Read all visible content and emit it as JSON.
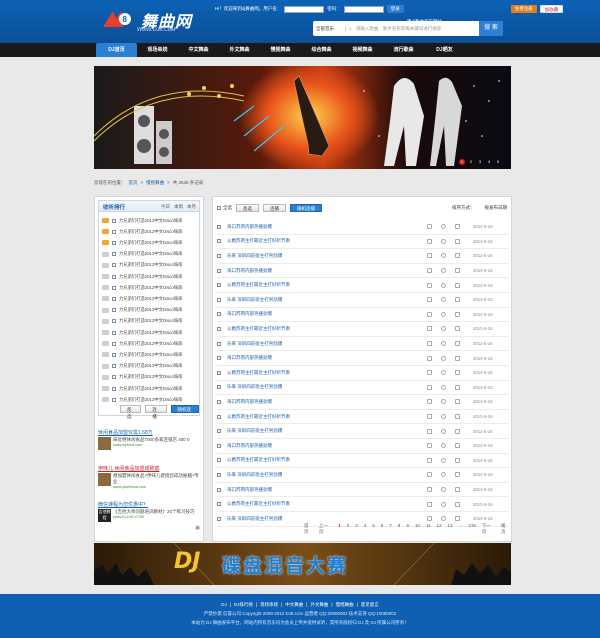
{
  "header": {
    "logo_text": "舞曲网",
    "logo_url": "WwW.DJ8.CoM",
    "welcome": "Hi！欢迎来到dj舞曲网。用户名：",
    "password_label": "密码：",
    "login_btn": "登录",
    "register_btn": "免费注册",
    "upload_link": "用dj舞曲发布网站",
    "favorite_link": "加收藏"
  },
  "search": {
    "scope": "全部音乐",
    "placeholder": "请输入歌曲、歌手名称及每关键词进行搜索",
    "button": "搜 索"
  },
  "nav": [
    {
      "label": "DJ首页",
      "active": true
    },
    {
      "label": "现场串烧",
      "active": false
    },
    {
      "label": "中文舞曲",
      "active": false
    },
    {
      "label": "外文舞曲",
      "active": false
    },
    {
      "label": "慢摇舞曲",
      "active": false
    },
    {
      "label": "综合舞曲",
      "active": false
    },
    {
      "label": "视频舞曲",
      "active": false
    },
    {
      "label": "流行歌曲",
      "active": false
    },
    {
      "label": "DJ晒友",
      "active": false
    }
  ],
  "banner_pages": [
    "1",
    "2",
    "3",
    "4",
    "5"
  ],
  "breadcrumb": {
    "prefix": "您现在的位置：",
    "home": "首页",
    "sep1": ">",
    "section": "慢摇舞曲",
    "sep2": ">",
    "count": "共 3536 条记录"
  },
  "ranking": {
    "title": "收听排行",
    "tabs": [
      "今日",
      "本周",
      "本月"
    ],
    "items": [
      "力兄弟们打造2012中文Disco嗨串",
      "力兄弟们打造2012中文Disco嗨串",
      "力兄弟们打造2012中文Disco嗨串",
      "力兄弟们打造2012中文Disco嗨串",
      "力兄弟们打造2012中文Disco嗨串",
      "力兄弟们打造2012中文Disco嗨串",
      "力兄弟们打造2012中文Disco嗨串",
      "力兄弟们打造2012中文Disco嗨串",
      "力兄弟们打造2012中文Disco嗨串",
      "力兄弟们打造2012中文Disco嗨串",
      "力兄弟们打造2012中文Disco嗨串",
      "力兄弟们打造2012中文Disco嗨串",
      "力兄弟们打造2012中文Disco嗨串",
      "力兄弟们打造2012中文Disco嗨串",
      "力兄弟们打造2012中文Disco嗨串",
      "力兄弟们打造2012中文Disco嗨串",
      "力兄弟们打造2012中文Disco嗨串"
    ],
    "btn_select": "反选",
    "btn_play": "连播",
    "btn_random": "随机连播"
  },
  "ads": [
    {
      "title": "休闲食品加盟仅需1.68万",
      "text": "味优特休闲食品7000多家连锁店 400 0",
      "url": "www.wyfood.com"
    },
    {
      "title": "伊味儿 休闲食品加盟成致富",
      "text": "想加盟休闲食品?伊味儿佬授您成功秘籍?专业",
      "url": "www.yiweifood.com"
    },
    {
      "title": "微信课程为您优惠中？",
      "text": "《吉他大师问题培训教材》20个练习技巧",
      "url": "www.KLLVR.COM",
      "thumb": "吉他教程"
    }
  ],
  "list": {
    "select_all": "全选",
    "btn_select": "反选",
    "btn_play": "连播",
    "btn_random": "随机连播",
    "sort_label": "排序方式：",
    "sort_value": "按发布日期",
    "songs": [
      {
        "title": "海口苏荷内部热播劲爆",
        "date": "2012-5-16"
      },
      {
        "title": "公爵苏荷主打最近主打好听节奏",
        "date": "2012-5-16"
      },
      {
        "title": "乐来 深圳四前街主打男劲爆",
        "date": "2012-5-16"
      },
      {
        "title": "海口苏荷内部热播劲爆",
        "date": "2012-5-16"
      },
      {
        "title": "公爵苏荷主打最近主打好听节奏",
        "date": "2012-5-16"
      },
      {
        "title": "乐来 深圳四前街主打男劲爆",
        "date": "2012-5-16"
      },
      {
        "title": "海口苏荷内部热播劲爆",
        "date": "2012-5-16"
      },
      {
        "title": "公爵苏荷主打最近主打好听节奏",
        "date": "2012-5-16"
      },
      {
        "title": "乐来 深圳四前街主打男劲爆",
        "date": "2012-5-16"
      },
      {
        "title": "海口苏荷内部热播劲爆",
        "date": "2012-5-16"
      },
      {
        "title": "公爵苏荷主打最近主打好听节奏",
        "date": "2012-5-16"
      },
      {
        "title": "乐来 深圳四前街主打男劲爆",
        "date": "2012-5-16"
      },
      {
        "title": "海口苏荷内部热播劲爆",
        "date": "2012-5-16"
      },
      {
        "title": "公爵苏荷主打最近主打好听节奏",
        "date": "2012-5-16"
      },
      {
        "title": "乐来 深圳四前街主打男劲爆",
        "date": "2012-5-16"
      },
      {
        "title": "海口苏荷内部热播劲爆",
        "date": "2012-5-16"
      },
      {
        "title": "公爵苏荷主打最近主打好听节奏",
        "date": "2012-5-16"
      },
      {
        "title": "乐来 深圳四前街主打男劲爆",
        "date": "2012-5-16"
      },
      {
        "title": "海口苏荷内部热播劲爆",
        "date": "2012-5-16"
      },
      {
        "title": "公爵苏荷主打最近主打好听节奏",
        "date": "2012-5-16"
      },
      {
        "title": "乐来 深圳四前街主打男劲爆",
        "date": "2012-5-16"
      }
    ],
    "pager": [
      "首页",
      "上一页",
      "1",
      "2",
      "3",
      "4",
      "5",
      "6",
      "7",
      "8",
      "9",
      "10",
      "11",
      "12",
      "13",
      "...",
      "215",
      "下一页",
      "尾页"
    ]
  },
  "bottom_banner": {
    "text_dj": "DJ",
    "text_cn": "碟盘混音大赛"
  },
  "footer": {
    "links": [
      "DJ",
      "|",
      "DJ排行榜",
      "|",
      "现场串烧",
      "|",
      "中文舞曲",
      "|",
      "外文舞曲",
      "|",
      "慢摇舞曲",
      "|",
      "意见留言"
    ],
    "line1": "严禁抄袭 信誉公司 Copyright 2009-2012 DJ8.com 运营者 QQ:20080002 技术支持 QQ:10080002",
    "line2": "本站为 DJ 舞曲发布平台，网站内所有音乐均为会员上传并提供试听，其所有版权归 DJ 及 DJ 所属公司所有！"
  },
  "colors": {
    "brand_blue": "#0d62b6",
    "nav_active": "#2b7fd4",
    "accent_red": "#d92020",
    "orange": "#f0a43a"
  }
}
